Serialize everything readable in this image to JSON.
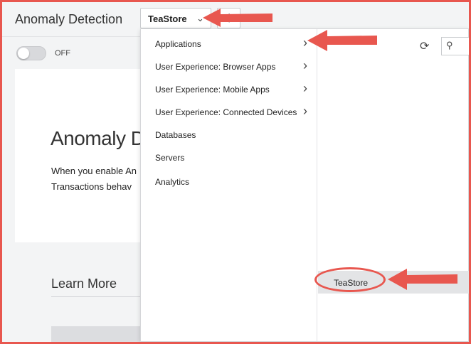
{
  "page": {
    "title": "Anomaly Detection",
    "toggle_label": "OFF",
    "app_select_value": "TeaStore",
    "card": {
      "heading": "Anomaly De",
      "description_line1": "When you enable An",
      "description_line2": "Transactions behav"
    },
    "learn_more": "Learn More"
  },
  "dropdown": {
    "menu_items": [
      {
        "label": "Applications",
        "has_submenu": true
      },
      {
        "label": "User Experience: Browser Apps",
        "has_submenu": true
      },
      {
        "label": "User Experience: Mobile Apps",
        "has_submenu": true
      },
      {
        "label": "User Experience: Connected Devices",
        "has_submenu": true
      },
      {
        "label": "Databases",
        "has_submenu": false
      },
      {
        "label": "Servers",
        "has_submenu": false
      },
      {
        "label": "Analytics",
        "has_submenu": false
      }
    ],
    "submenu_items": [
      {
        "label": "TeaStore"
      }
    ]
  },
  "icons": {
    "chevron": "chevron-down-icon",
    "gear": "gear-icon",
    "refresh": "refresh-icon",
    "search": "search-icon",
    "submenu": "chevron-right-icon"
  },
  "colors": {
    "annotation": "#e8574f",
    "selected_row": "#e3e4e6"
  }
}
